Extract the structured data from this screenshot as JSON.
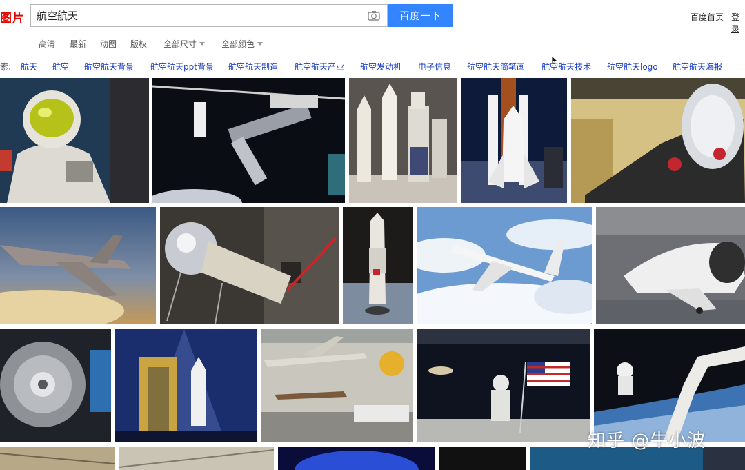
{
  "header": {
    "logo": "图片",
    "search_value": "航空航天",
    "search_button": "百度一下",
    "links": [
      "百度首页",
      "登录"
    ]
  },
  "filters": [
    {
      "label": "高清",
      "dropdown": false
    },
    {
      "label": "最新",
      "dropdown": false
    },
    {
      "label": "动图",
      "dropdown": false
    },
    {
      "label": "版权",
      "dropdown": false
    },
    {
      "label": "全部尺寸",
      "dropdown": true
    },
    {
      "label": "全部颜色",
      "dropdown": true
    }
  ],
  "related": {
    "prefix": "索:",
    "items": [
      "航天",
      "航空",
      "航空航天背景",
      "航空航天ppt背景",
      "航空航天制造",
      "航空航天产业",
      "航空发动机",
      "电子信息",
      "航空航天简笔画",
      "航空航天技术",
      "航空航天logo",
      "航空航天海报"
    ]
  },
  "images": {
    "row1": [
      "astronaut-spacesuit",
      "space-station-model",
      "long-march-rockets",
      "space-shuttle-launch",
      "jet-engine"
    ],
    "row2": [
      "fighter-jet-clouds",
      "sputnik-satellite",
      "shenzhou-spacecraft",
      "airliner-above-clouds",
      "space-shuttle-museum"
    ],
    "row3": [
      "radial-engine",
      "shuttle-launch-night",
      "air-museum-hall",
      "moon-landing-astronaut",
      "astronaut-robotic-arm"
    ]
  },
  "watermark": "知乎 @牛小波",
  "colors": {
    "brand_red": "#e10601",
    "button_blue": "#3385ff",
    "link_blue": "#1a3ec6"
  }
}
